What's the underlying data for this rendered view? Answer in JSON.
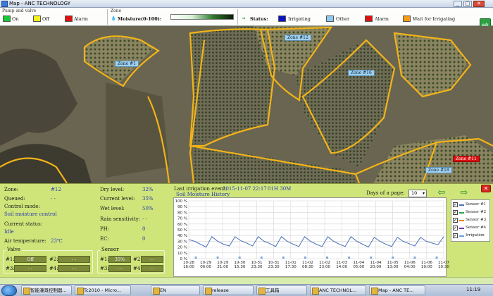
{
  "window": {
    "title": "Map - ANC TECHNOLOGY"
  },
  "legend": {
    "pump_valve_title": "Pump and valve",
    "pump_items": [
      {
        "label": "On",
        "color": "#17c93a"
      },
      {
        "label": "Off",
        "color": "#f7f21a"
      },
      {
        "label": "Alarm",
        "color": "#e01010"
      }
    ],
    "zone_title": "Zone",
    "moisture_label": "Moisture(0-100):",
    "status_label": "Status:",
    "status_items": [
      {
        "label": "Irrigating",
        "color": "#0a13c7"
      },
      {
        "label": "Other",
        "color": "#8ec9ef"
      },
      {
        "label": "Alarm",
        "color": "#e01010"
      },
      {
        "label": "Wait for Irrigating",
        "color": "#f39a16"
      }
    ]
  },
  "map": {
    "zones": [
      {
        "label": "Zone #1",
        "state": "other"
      },
      {
        "label": "Zone #12",
        "state": "other"
      },
      {
        "label": "Zone #16",
        "state": "other"
      },
      {
        "label": "Zone #18",
        "state": "other"
      },
      {
        "label": "Zone #11",
        "state": "alarm"
      }
    ]
  },
  "info": {
    "zone_label": "Zone:",
    "zone_value": "#12",
    "queued_label": "Queued:",
    "queued_value": "- -",
    "control_mode_label": "Control mode:",
    "control_mode_value": "Soil moisture control",
    "current_status_label": "Current status:",
    "current_status_value": "Idle",
    "air_temp_label": "Air temperature:",
    "air_temp_value": "23℃",
    "dry_level_label": "Dry level:",
    "dry_level_value": "32%",
    "current_level_label": "Current level:",
    "current_level_value": "35%",
    "wet_level_label": "Wet level:",
    "wet_level_value": "50%",
    "rain_label": "Rain sensitivity:",
    "rain_value": "- -",
    "ph_label": "PH:",
    "ph_value": "0",
    "ec_label": "EC:",
    "ec_value": "0",
    "valve_title": "Valve",
    "valve": [
      {
        "key": "#1:",
        "value": "Off"
      },
      {
        "key": "#2:",
        "value": "- -"
      },
      {
        "key": "#3:",
        "value": "- -"
      },
      {
        "key": "#4:",
        "value": "- -"
      }
    ],
    "sensor_title": "Sensor",
    "sensor": [
      {
        "key": "#1:",
        "value": "35%"
      },
      {
        "key": "#2:",
        "value": "- -"
      },
      {
        "key": "#3:",
        "value": "- -"
      },
      {
        "key": "#4:",
        "value": "- -"
      }
    ]
  },
  "chart_panel": {
    "last_event_label": "Last irrigation event:",
    "last_event_time": "2015-11-07 22:17",
    "last_event_duration": "01H 30M",
    "days_label": "Days of a page:",
    "days_value": "10",
    "close_glyph": "✕",
    "prev_arrow": "⇦",
    "next_arrow": "⇨"
  },
  "chart_data": {
    "type": "line",
    "title": "Soil Moisture History",
    "ylim": [
      0,
      100
    ],
    "y_ticks": [
      "0 %",
      "10 %",
      "20 %",
      "30 %",
      "40 %",
      "50 %",
      "60 %",
      "70 %",
      "80 %",
      "90 %",
      "100 %"
    ],
    "x_ticks": [
      [
        "10-28",
        "16:00"
      ],
      [
        "10-29",
        "06:00"
      ],
      [
        "10-29",
        "21:00"
      ],
      [
        "10-30",
        "15:30"
      ],
      [
        "10-31",
        "23:30"
      ],
      [
        "10-31",
        "23:30"
      ],
      [
        "11-01",
        "17:30"
      ],
      [
        "11-02",
        "08:30"
      ],
      [
        "11-02",
        "23:00"
      ],
      [
        "11-03",
        "14:00"
      ],
      [
        "11-04",
        "05:00"
      ],
      [
        "11-04",
        "20:00"
      ],
      [
        "11-05",
        "13:00"
      ],
      [
        "11-06",
        "04:00"
      ],
      [
        "11-06",
        "19:00"
      ],
      [
        "11-07",
        "10:30"
      ]
    ],
    "series": [
      {
        "name": "Sensor #1",
        "color": "#4a72b8",
        "values": [
          33,
          30,
          25,
          20,
          38,
          30,
          25,
          22,
          38,
          31,
          27,
          22,
          38,
          30,
          26,
          21,
          38,
          30,
          25,
          21,
          38,
          30,
          25,
          21,
          38,
          30,
          25,
          21,
          38,
          30,
          25,
          20,
          37,
          30,
          25,
          21,
          37,
          30,
          26,
          22,
          37,
          30,
          27,
          24,
          38
        ]
      }
    ],
    "irrigation_events": 12,
    "legend": [
      {
        "label": "Sensor #1",
        "color": "#4a72b8",
        "checked": true
      },
      {
        "label": "Sensor #2",
        "color": "#2aa34a",
        "checked": true
      },
      {
        "label": "Sensor #3",
        "color": "#e08a1a",
        "checked": true
      },
      {
        "label": "Sensor #4",
        "color": "#7a3ab0",
        "checked": true
      },
      {
        "label": "Irrigation",
        "color": "#6c9fd8",
        "checked": true
      }
    ]
  },
  "taskbar": {
    "items": [
      "智能灌溉控制器...",
      "Tc2010 - Micro...",
      "EN",
      "release",
      "工具箱",
      "ANC TECHNOL...",
      "Map - ANC TE..."
    ],
    "clock": "11:19"
  }
}
